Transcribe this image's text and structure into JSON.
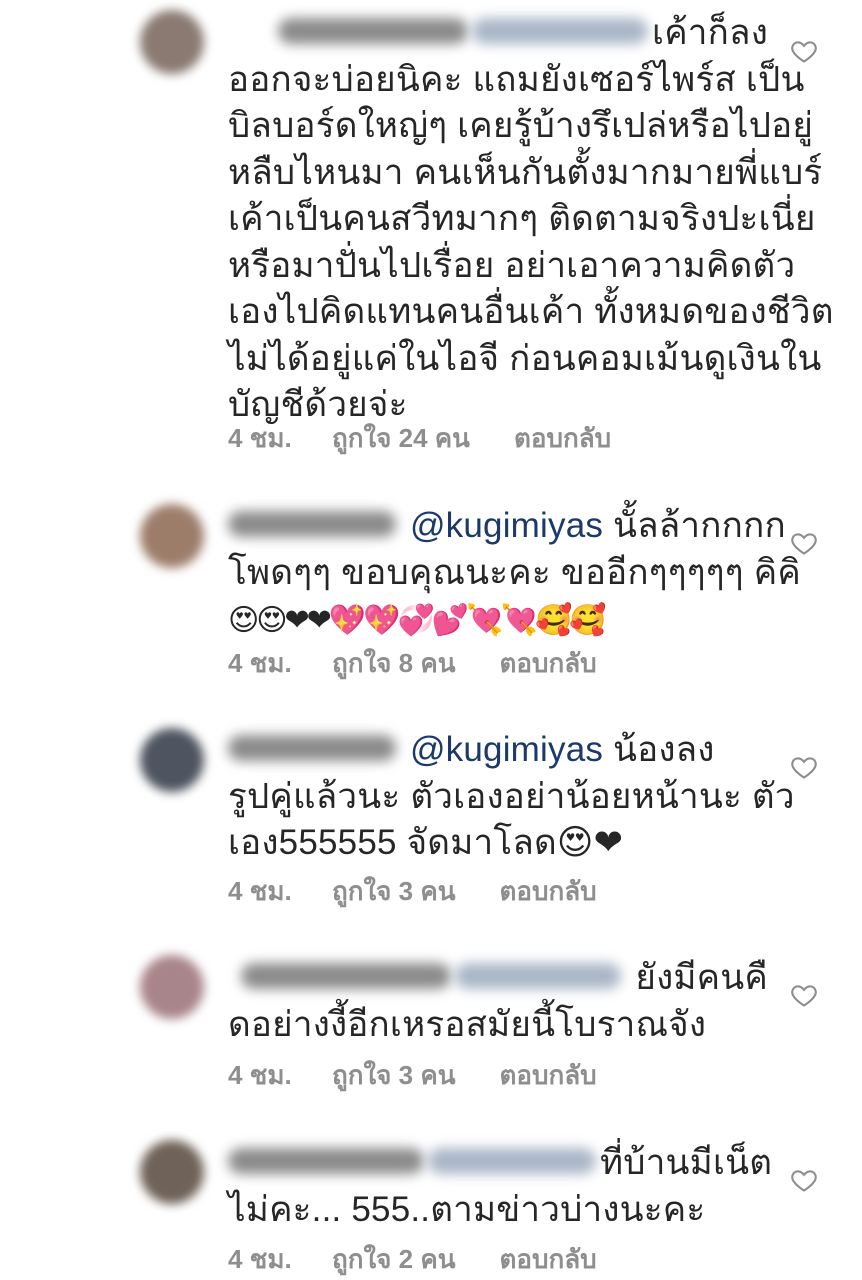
{
  "comments": [
    {
      "avatar_color": "#8a7a72",
      "mention": "",
      "lines": [
        "เค้าก็ลง",
        "ออกจะบ่อยนิคะ แถมยังเซอร์ไพร์ส เป็น",
        "บิลบอร์ดใหญ่ๆ เคยรู้บ้างรึเปล่หรือไปอยู่",
        "หลืบไหนมา คนเห็นกันตั้งมากมายพี่แบร์",
        "เค้าเป็นคนสวีทมากๆ ติดตามจริงปะเนี่ย",
        "หรือมาปั่นไปเรื่อย อย่าเอาความคิดตัว",
        "เองไปคิดแทนคนอื่นเค้า ทั้งหมดของชีวิต",
        "ไม่ได้อยู่แค่ในไอจี ก่อนคอมเม้นดูเงินใน",
        "บัญชีด้วยจ่ะ"
      ],
      "time": "4 ชม.",
      "likes": "ถูกใจ 24 คน",
      "reply": "ตอบกลับ"
    },
    {
      "avatar_color": "#9c7d6a",
      "mention": "@kugimiyas",
      "lines": [
        "นั้ลล้ากกกก",
        "โพดๆๆ ขอบคุณนะคะ ขออีกๆๆๆๆๆ คิคิ"
      ],
      "emoji_line": "😍😍❤❤💖💖💞💕💘💘🥰🥰",
      "time": "4 ชม.",
      "likes": "ถูกใจ 8 คน",
      "reply": "ตอบกลับ"
    },
    {
      "avatar_color": "#4e5560",
      "mention": "@kugimiyas",
      "lines": [
        "น้องลง",
        "รูปคู่แล้วนะ ตัวเองอย่าน้อยหน้านะ ตัว",
        "เอง555555 จัดมาโลด😍❤"
      ],
      "time": "4 ชม.",
      "likes": "ถูกใจ 3 คน",
      "reply": "ตอบกลับ"
    },
    {
      "avatar_color": "#a8858a",
      "mention": "",
      "lines": [
        "ยังมีคนคื",
        "ดอย่างงี้อีกเหรอสมัยนี้โบราณจัง"
      ],
      "time": "4 ชม.",
      "likes": "ถูกใจ 3 คน",
      "reply": "ตอบกลับ"
    },
    {
      "avatar_color": "#6f6258",
      "mention": "",
      "lines": [
        "ที่บ้านมีเน็ต",
        "ไม่คะ... 555..ตามข่าวบ่างนะคะ"
      ],
      "time": "4 ชม.",
      "likes": "ถูกใจ 2 คน",
      "reply": "ตอบกลับ"
    }
  ],
  "colors": {
    "text": "#262626",
    "meta": "#8e8e8e",
    "mention": "#1b3a6b",
    "heart_outline": "#8e8e8e"
  },
  "icons": {
    "like": "heart-outline-icon"
  }
}
